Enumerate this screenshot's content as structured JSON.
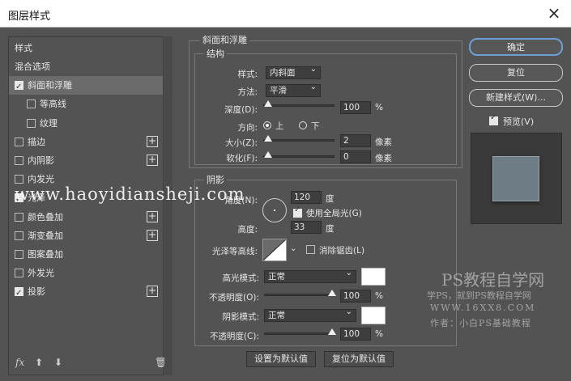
{
  "window": {
    "title": "图层样式",
    "close_icon": "×"
  },
  "left_panel": {
    "header": "样式",
    "items": [
      {
        "label": "混合选项",
        "checkbox": false,
        "has_cb": false,
        "plus": false,
        "indent": false
      },
      {
        "label": "斜面和浮雕",
        "checkbox": true,
        "has_cb": true,
        "plus": false,
        "indent": false,
        "selected": true
      },
      {
        "label": "等高线",
        "checkbox": false,
        "has_cb": true,
        "plus": false,
        "indent": true
      },
      {
        "label": "纹理",
        "checkbox": false,
        "has_cb": true,
        "plus": false,
        "indent": true
      },
      {
        "label": "描边",
        "checkbox": false,
        "has_cb": true,
        "plus": true,
        "indent": false
      },
      {
        "label": "内阴影",
        "checkbox": false,
        "has_cb": true,
        "plus": true,
        "indent": false
      },
      {
        "label": "内发光",
        "checkbox": false,
        "has_cb": true,
        "plus": false,
        "indent": false
      },
      {
        "label": "光泽",
        "checkbox": true,
        "has_cb": true,
        "plus": false,
        "indent": false
      },
      {
        "label": "颜色叠加",
        "checkbox": false,
        "has_cb": true,
        "plus": true,
        "indent": false
      },
      {
        "label": "渐变叠加",
        "checkbox": false,
        "has_cb": true,
        "plus": true,
        "indent": false
      },
      {
        "label": "图案叠加",
        "checkbox": false,
        "has_cb": true,
        "plus": false,
        "indent": false
      },
      {
        "label": "外发光",
        "checkbox": false,
        "has_cb": true,
        "plus": false,
        "indent": false
      },
      {
        "label": "投影",
        "checkbox": true,
        "has_cb": true,
        "plus": true,
        "indent": false
      }
    ],
    "footer": {
      "fx": "fx",
      "up": "⬆",
      "down": "⬇",
      "trash": "🗑"
    }
  },
  "bevel": {
    "section_title": "斜面和浮雕",
    "structure_title": "结构",
    "style_label": "样式:",
    "style_value": "内斜面",
    "technique_label": "方法:",
    "technique_value": "平滑",
    "depth_label": "深度(D):",
    "depth_value": "100",
    "depth_unit": "%",
    "depth_level": 0.0,
    "direction_label": "方向:",
    "direction_up": "上",
    "direction_down": "下",
    "size_label": "大小(Z):",
    "size_value": "2",
    "size_unit": "像素",
    "size_level": 0.0,
    "soften_label": "软化(F):",
    "soften_value": "0",
    "soften_unit": "像素",
    "soften_level": 0.0
  },
  "shading": {
    "title": "阴影",
    "angle_label": "角度(N):",
    "angle_value": "120",
    "angle_unit": "度",
    "global_light_label": "使用全局光(G)",
    "global_light": true,
    "altitude_label": "高度:",
    "altitude_value": "33",
    "altitude_unit": "度",
    "gloss_label": "光泽等高线:",
    "antialias_label": "消除锯齿(L)",
    "antialias": false,
    "highlight_mode_label": "高光模式:",
    "highlight_mode_value": "正常",
    "highlight_opacity_label": "不透明度(O):",
    "highlight_opacity_value": "100",
    "highlight_opacity_unit": "%",
    "highlight_opacity_level": 1.0,
    "shadow_mode_label": "阴影模式:",
    "shadow_mode_value": "正常",
    "shadow_opacity_label": "不透明度(C):",
    "shadow_opacity_value": "100",
    "shadow_opacity_unit": "%",
    "shadow_opacity_level": 1.0,
    "highlight_color": "#ffffff",
    "shadow_color": "#ffffff"
  },
  "buttons": {
    "make_default": "设置为默认值",
    "reset_default": "复位为默认值",
    "ok": "确定",
    "reset": "复位",
    "new_style": "新建样式(W)...",
    "preview_label": "预览(V)",
    "preview": true
  },
  "watermarks": {
    "site": "www.haoyidiansheji.com",
    "brand": "PS教程自学网",
    "tagline": "学PS，就到PS教程自学网",
    "url": "WWW.16XX8.COM",
    "author": "作者：小白PS基础教程"
  }
}
